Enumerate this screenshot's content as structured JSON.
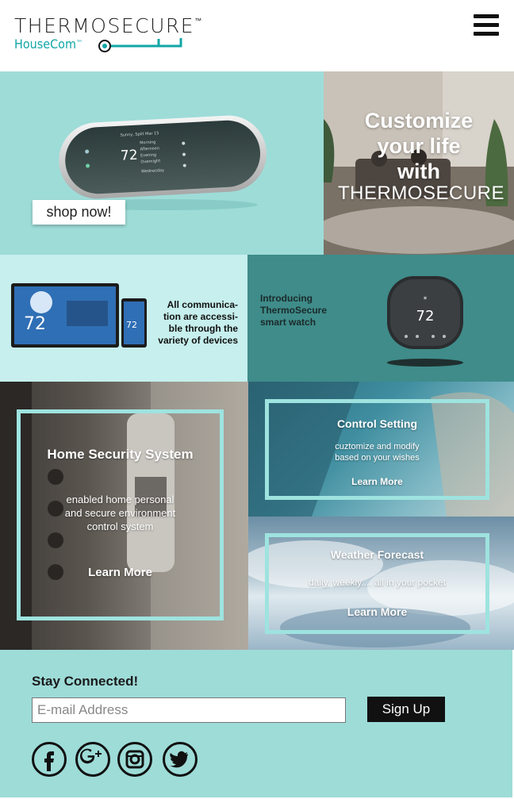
{
  "header": {
    "logo_main": "THERMOSECURE",
    "logo_main_tm": "™",
    "logo_sub": "HouseCom",
    "logo_sub_tm": "™",
    "menu_icon": "hamburger-menu-icon"
  },
  "hero": {
    "title_lines": [
      "Customize",
      "your life",
      "with"
    ],
    "brand": "THERMOSECURE",
    "shop_button": "shop now!",
    "thermostat": {
      "temperature": "72",
      "date": "Sunny, Split Mar 15",
      "rows": [
        "Morning",
        "Afternoon",
        "Evening",
        "Overnight"
      ],
      "bottom": "Wednesday"
    }
  },
  "devices": {
    "text_lines": [
      "All communica-",
      "tion are accessi-",
      "ble through the",
      "variety of devices"
    ],
    "temperature": "72"
  },
  "watch": {
    "text_lines": [
      "Introducing",
      "ThermoSecure",
      "smart watch"
    ],
    "temperature": "72"
  },
  "security": {
    "title": "Home Security System",
    "text_lines": [
      "enabled home personal",
      "and secure environment",
      "control system"
    ],
    "link": "Learn More"
  },
  "control": {
    "title": "Control Setting",
    "text_lines": [
      "cuztomize and modify",
      "based on your wishes"
    ],
    "link": "Learn More"
  },
  "weather": {
    "title": "Weather Forecast",
    "text": "daily, weekly.... all in your pocket",
    "link": "Learn More"
  },
  "footer": {
    "title": "Stay Connected!",
    "email_placeholder": "E-mail Address",
    "signup": "Sign Up",
    "social_icons": [
      "facebook-icon",
      "google-plus-icon",
      "instagram-icon",
      "twitter-icon"
    ]
  },
  "colors": {
    "accent": "#12a6a6",
    "light_teal": "#9edcd8",
    "pale_teal": "#c6efed",
    "dark_teal": "#3f8c8a"
  }
}
